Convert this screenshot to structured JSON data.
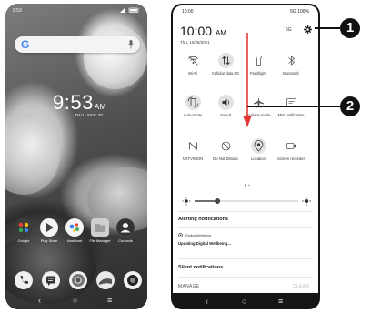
{
  "home": {
    "status_time": "9:53",
    "clock_time": "9:53",
    "clock_ampm": "AM",
    "date": "THU, SEP 30",
    "apps": [
      {
        "label": "Google",
        "color": "#3b3b3b"
      },
      {
        "label": "Play Store",
        "color": "#f5f5f5"
      },
      {
        "label": "Assistant",
        "color": "#f5f5f5"
      },
      {
        "label": "File Manager",
        "color": "#cfcfcf"
      },
      {
        "label": "Contacts",
        "color": "#f5f5f5"
      }
    ],
    "dock": [
      {
        "name": "phone",
        "color": "#f0f0f0"
      },
      {
        "name": "messages",
        "color": "#f0f0f0"
      },
      {
        "name": "chrome",
        "color": "#f0f0f0"
      },
      {
        "name": "gallery",
        "color": "#e8e8e8"
      },
      {
        "name": "camera",
        "color": "#f0f0f0"
      }
    ],
    "nav": {
      "back": "‹",
      "home": "○",
      "recents": "≡"
    }
  },
  "qs": {
    "status_time": "10:00",
    "status_right": "5G 100%",
    "clock_time": "10:00",
    "clock_ampm": "AM",
    "date": "Thu, 10/28/2021",
    "network": "5G",
    "tiles": [
      {
        "label": "Wi-Fi",
        "icon": "wifi-icon",
        "on": false
      },
      {
        "label": "Cellular data 5G",
        "icon": "cellular-data-icon",
        "on": true
      },
      {
        "label": "Flashlight",
        "icon": "flashlight-icon",
        "on": false
      },
      {
        "label": "Bluetooth",
        "icon": "bluetooth-icon",
        "on": false
      },
      {
        "label": "Auto-rotate",
        "icon": "auto-rotate-icon",
        "on": true
      },
      {
        "label": "Sound",
        "icon": "sound-icon",
        "on": true
      },
      {
        "label": "Airplane mode",
        "icon": "airplane-icon",
        "on": false
      },
      {
        "label": "Mini notification",
        "icon": "mini-notification-icon",
        "on": false
      },
      {
        "label": "NXTVISION",
        "icon": "nxtvision-icon",
        "on": false
      },
      {
        "label": "Do Not Disturb",
        "icon": "do-not-disturb-icon",
        "on": false
      },
      {
        "label": "Location",
        "icon": "location-icon",
        "on": true
      },
      {
        "label": "Screen recorder",
        "icon": "screen-recorder-icon",
        "on": false
      }
    ],
    "brightness_level": 0.22,
    "alerting_title": "Alerting notifications",
    "wellbeing_app": "Digital Wellbeing",
    "wellbeing_text": "Updating Digital Wellbeing...",
    "silent_title": "Silent notifications",
    "manage_label": "MANAGE",
    "clear_label": "CLEAR",
    "nav": {
      "back": "‹",
      "home": "○",
      "recents": "≡"
    }
  },
  "callouts": {
    "one": "1",
    "two": "2"
  },
  "colors": {
    "accent_red": "#e53935",
    "tile_on": "#e2e2e2",
    "panel_bg": "#ffffff"
  }
}
